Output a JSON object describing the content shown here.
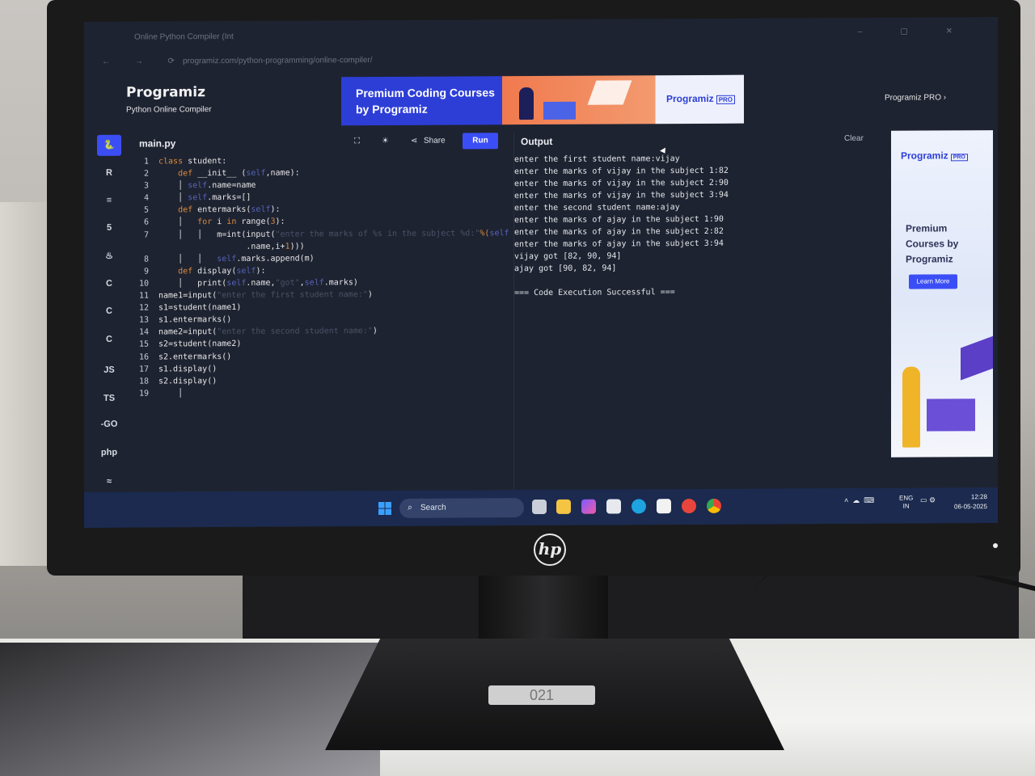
{
  "browser": {
    "tab_title": "Online Python Compiler (Int",
    "url": "programiz.com/python-programming/online-compiler/",
    "nav_icons": "← → ⟳",
    "window_controls": "– ▢ ✕"
  },
  "brand": {
    "logo": "Programiz",
    "subtitle": "Python Online Compiler"
  },
  "banner": {
    "headline": "Premium Coding Courses by Programiz",
    "pro_logo": "Programiz",
    "pro_tag": "PRO"
  },
  "pro_link": "Programiz PRO ›",
  "sidebar": {
    "items": [
      {
        "label": "🐍",
        "name": "python"
      },
      {
        "label": "R",
        "name": "r"
      },
      {
        "label": "≡",
        "name": "sql"
      },
      {
        "label": "5",
        "name": "html"
      },
      {
        "label": "♨",
        "name": "java"
      },
      {
        "label": "C",
        "name": "c"
      },
      {
        "label": "C",
        "name": "cpp"
      },
      {
        "label": "C",
        "name": "csharp"
      },
      {
        "label": "JS",
        "name": "javascript"
      },
      {
        "label": "TS",
        "name": "typescript"
      },
      {
        "label": "-GO",
        "name": "go"
      },
      {
        "label": "php",
        "name": "php"
      },
      {
        "label": "≈",
        "name": "swift"
      }
    ]
  },
  "editor": {
    "filename": "main.py",
    "share_label": "Share",
    "run_label": "Run",
    "icons": {
      "fullscreen": "⛶",
      "theme": "☀",
      "share": "⋖"
    }
  },
  "output": {
    "title": "Output",
    "clear_label": "Clear",
    "lines": [
      "enter the first student name:vijay",
      "enter the marks of vijay in the subject 1:82",
      "enter the marks of vijay in the subject 2:90",
      "enter the marks of vijay in the subject 3:94",
      "enter the second student name:ajay",
      "enter the marks of ajay in the subject 1:90",
      "enter the marks of ajay in the subject 2:82",
      "enter the marks of ajay in the subject 3:94",
      "vijay got [82, 90, 94]",
      "ajay got [90, 82, 94]",
      "",
      "=== Code Execution Successful ==="
    ]
  },
  "ad": {
    "logo": "Programiz",
    "tag": "PRO",
    "text": "Premium Courses by Programiz",
    "button": "Learn More"
  },
  "taskbar": {
    "search_label": "Search",
    "lang_line1": "ENG",
    "lang_line2": "IN",
    "time": "12:28",
    "date": "06-05-2025"
  },
  "monitor": {
    "brand": "hp",
    "label": "021"
  }
}
